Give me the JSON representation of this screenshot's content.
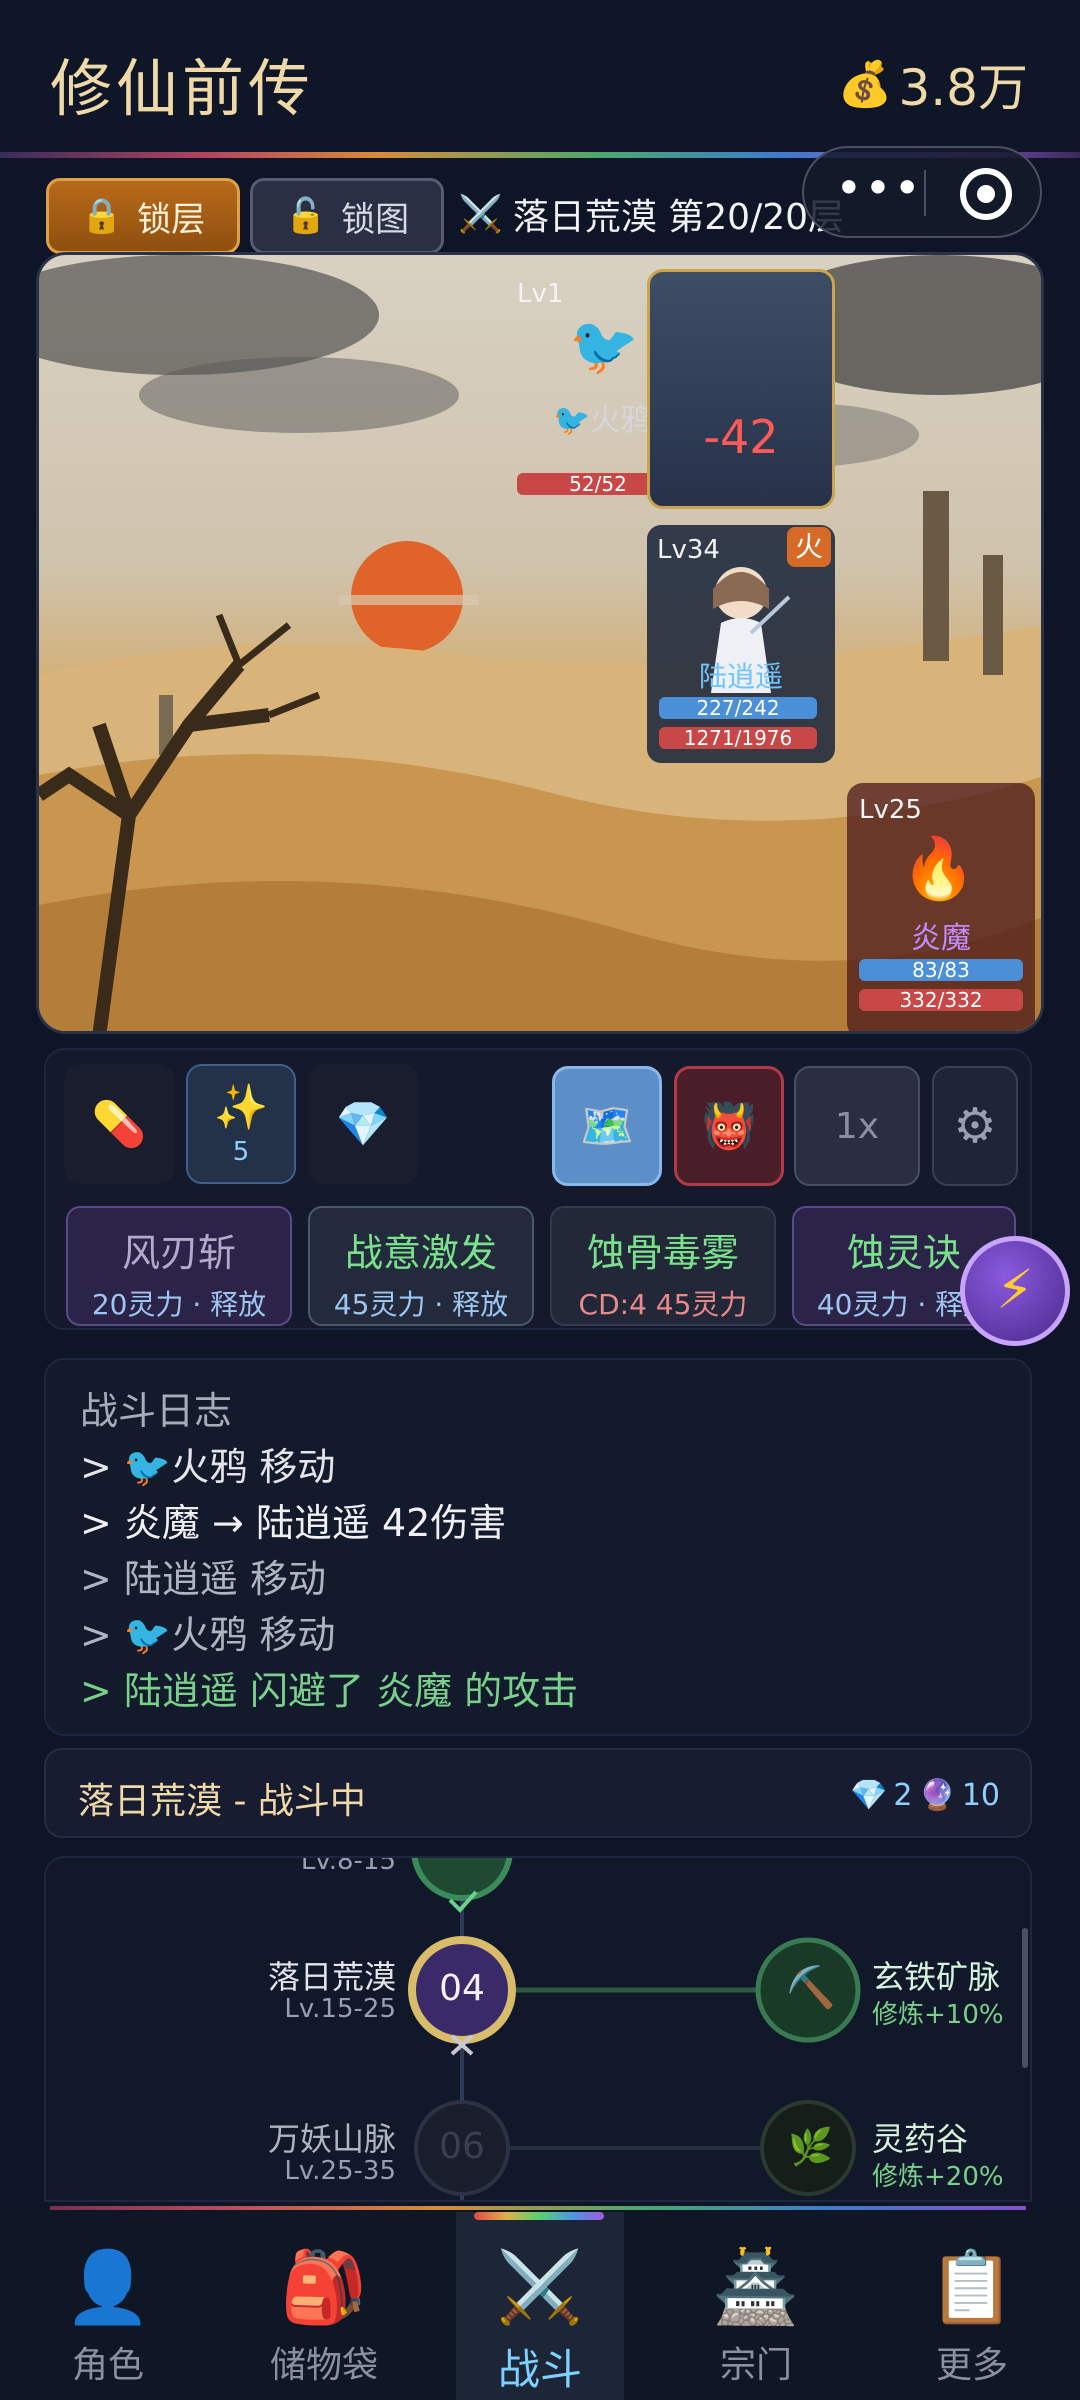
{
  "header": {
    "title": "修仙前传",
    "currency_icon": "money-bag-icon",
    "currency": "3.8万"
  },
  "toolbar": {
    "lock_floor_label": "锁层",
    "lock_map_label": "锁图",
    "stage_label": "落日荒漠 第20/20层"
  },
  "battle": {
    "enemy_crow": {
      "level": "Lv1",
      "name": "火鸦",
      "hp": "52/52"
    },
    "damage": "-42",
    "hero": {
      "level": "Lv34",
      "element": "火",
      "name": "陆逍遥",
      "mp": "227/242",
      "hp": "1271/1976"
    },
    "boss": {
      "level": "Lv25",
      "name": "炎魔",
      "mp": "83/83",
      "hp": "332/332"
    }
  },
  "items": {
    "spark_count": "5"
  },
  "controls": {
    "speed": "1x"
  },
  "skills": [
    {
      "name": "风刃斩",
      "desc": "20灵力 · 释放"
    },
    {
      "name": "战意激发",
      "desc": "45灵力 · 释放"
    },
    {
      "name": "蚀骨毒雾",
      "desc": "CD:4  45灵力"
    },
    {
      "name": "蚀灵诀",
      "desc": "40灵力 · 释放"
    }
  ],
  "log": {
    "title": "战斗日志",
    "lines": [
      "> 🐦火鸦 移动",
      "> 炎魔 → 陆逍遥 42伤害",
      "> 陆逍遥 移动",
      "> 🐦火鸦 移动",
      "> 陆逍遥 闪避了 炎魔 的攻击"
    ]
  },
  "status": {
    "text": "落日荒漠 - 战斗中",
    "gems": "2",
    "orbs": "10"
  },
  "map": {
    "prev_lv": "Lv.8-15",
    "nodes": [
      {
        "name": "落日荒漠",
        "lv": "Lv.15-25",
        "num": "04"
      },
      {
        "name": "万妖山脉",
        "lv": "Lv.25-35",
        "num": "06"
      }
    ],
    "sides": [
      {
        "name": "玄铁矿脉",
        "bonus": "修炼+10%"
      },
      {
        "name": "灵药谷",
        "bonus": "修炼+20%"
      }
    ]
  },
  "nav": [
    {
      "label": "角色"
    },
    {
      "label": "储物袋"
    },
    {
      "label": "战斗"
    },
    {
      "label": "宗门"
    },
    {
      "label": "更多"
    }
  ],
  "colors": {
    "accent_gold": "#efd9a8",
    "hp_red": "#c84848",
    "mp_blue": "#4a8fd8",
    "log_green": "#7ad08a",
    "active_tab": "#7fd0ff"
  }
}
